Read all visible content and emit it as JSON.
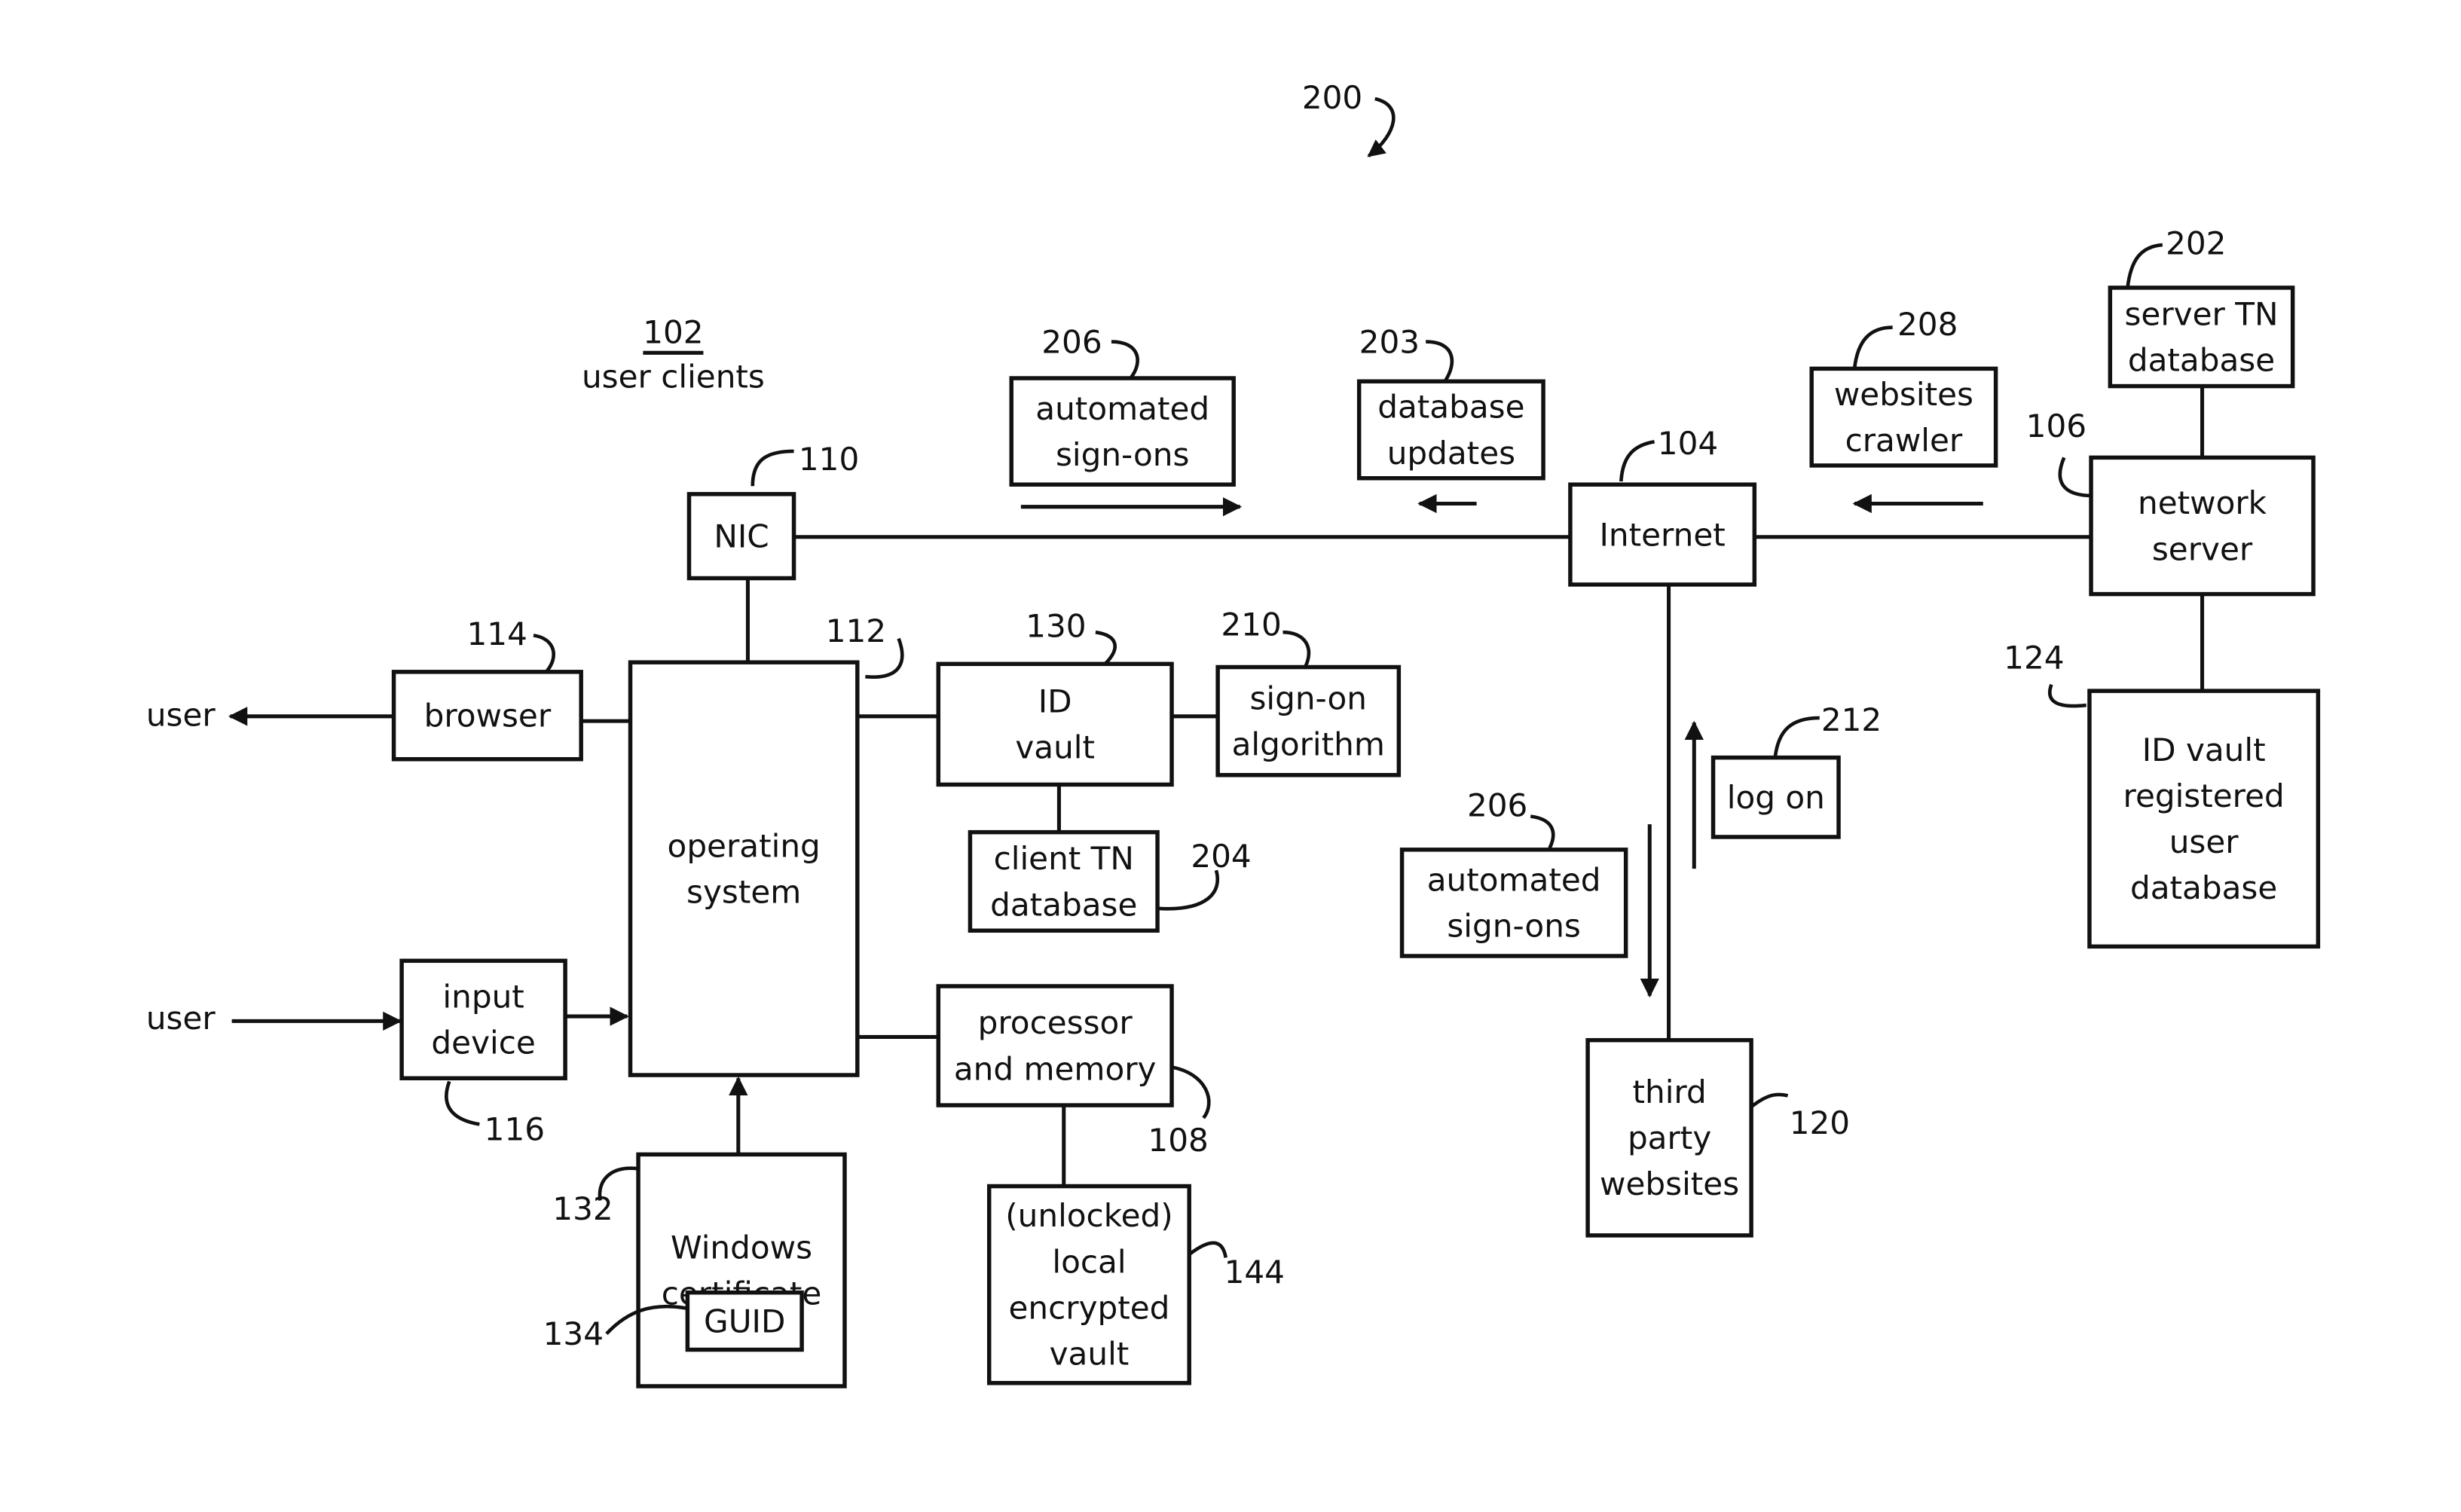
{
  "figure": {
    "number": "200",
    "group_ref": "102",
    "group_label": "user clients"
  },
  "nodes": {
    "nic": {
      "ref": "110",
      "lines": [
        "NIC"
      ]
    },
    "browser": {
      "ref": "114",
      "lines": [
        "browser"
      ]
    },
    "os": {
      "ref": "112",
      "lines": [
        "operating",
        "system"
      ]
    },
    "id_vault": {
      "ref": "130",
      "lines": [
        "ID",
        "vault"
      ]
    },
    "signon_algorithm": {
      "ref": "210",
      "lines": [
        "sign-on",
        "algorithm"
      ]
    },
    "client_tn_db": {
      "ref": "204",
      "lines": [
        "client TN",
        "database"
      ]
    },
    "input_device": {
      "ref": "116",
      "lines": [
        "input",
        "device"
      ]
    },
    "processor_memory": {
      "ref": "108",
      "lines": [
        "processor",
        "and memory"
      ]
    },
    "windows_cert": {
      "ref": "132",
      "lines": [
        "Windows",
        "certificate"
      ]
    },
    "guid": {
      "ref": "134",
      "lines": [
        "GUID"
      ]
    },
    "local_vault": {
      "ref": "144",
      "lines": [
        "(unlocked)",
        "local",
        "encrypted",
        "vault"
      ]
    },
    "auto_signons_top": {
      "ref": "206",
      "lines": [
        "automated",
        "sign-ons"
      ]
    },
    "db_updates": {
      "ref": "203",
      "lines": [
        "database",
        "updates"
      ]
    },
    "internet": {
      "ref": "104",
      "lines": [
        "Internet"
      ]
    },
    "websites_crawler": {
      "ref": "208",
      "lines": [
        "websites",
        "crawler"
      ]
    },
    "server_tn_db": {
      "ref": "202",
      "lines": [
        "server TN",
        "database"
      ]
    },
    "network_server": {
      "ref": "106",
      "lines": [
        "network",
        "server"
      ]
    },
    "id_vault_db": {
      "ref": "124",
      "lines": [
        "ID vault",
        "registered",
        "user",
        "database"
      ]
    },
    "log_on": {
      "ref": "212",
      "lines": [
        "log on"
      ]
    },
    "auto_signons_bottom": {
      "ref": "206",
      "lines": [
        "automated",
        "sign-ons"
      ]
    },
    "third_party": {
      "ref": "120",
      "lines": [
        "third",
        "party",
        "websites"
      ]
    }
  },
  "external": {
    "user_out": "user",
    "user_in": "user"
  }
}
